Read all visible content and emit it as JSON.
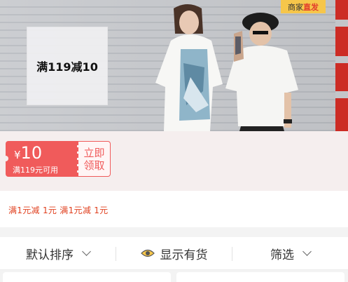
{
  "banner": {
    "promo_text": "满119减10",
    "badge": {
      "part1": "商家",
      "part2": "直发"
    }
  },
  "coupon": {
    "currency": "¥",
    "amount": "10",
    "condition": "满119元可用",
    "action_line1": "立即",
    "action_line2": "领取"
  },
  "discount_text": "满1元减 1元  满1元减 1元",
  "sort_bar": {
    "default_sort": "默认排序",
    "in_stock": "显示有货",
    "filter": "筛选"
  },
  "colors": {
    "accent": "#f05b5b",
    "discount_text": "#e0401f",
    "badge_bg": "#f6c64a"
  }
}
